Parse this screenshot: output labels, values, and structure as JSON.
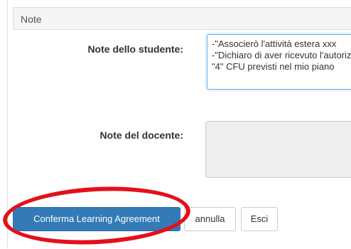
{
  "section": {
    "title": "Note"
  },
  "student_notes": {
    "label": "Note dello studente:",
    "lines": [
      "-\"Associerò l'attività estera xxx",
      "-\"Dichiaro di aver ricevuto l'autorizzazione",
      "\"4\" CFU previsti nel mio piano"
    ]
  },
  "teacher_notes": {
    "label": "Note del docente:",
    "value": ""
  },
  "actions": {
    "confirm_label": "Conferma Learning Agreement",
    "cancel_label": "annulla",
    "exit_label": "Esci"
  },
  "annotation": {
    "color": "#e3101b"
  }
}
